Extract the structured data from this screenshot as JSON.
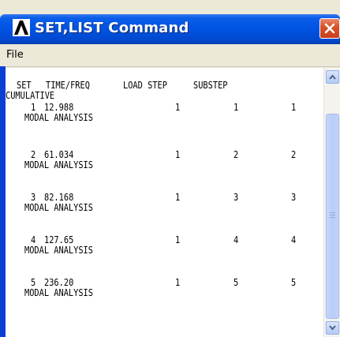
{
  "window": {
    "title": "SET,LIST Command",
    "menu": [
      "File"
    ]
  },
  "listing": {
    "headers": {
      "set": "SET",
      "time_freq": "TIME/FREQ",
      "load_step": "LOAD STEP",
      "substep": "SUBSTEP",
      "cumulative": "CUMULATIVE"
    },
    "rows": [
      {
        "set": "1",
        "time_freq": "12.988",
        "load_step": "1",
        "substep": "1",
        "cumulative": "1",
        "label": "MODAL ANALYSIS"
      },
      {
        "set": "2",
        "time_freq": "61.034",
        "load_step": "1",
        "substep": "2",
        "cumulative": "2",
        "label": "MODAL ANALYSIS"
      },
      {
        "set": "3",
        "time_freq": "82.168",
        "load_step": "1",
        "substep": "3",
        "cumulative": "3",
        "label": "MODAL ANALYSIS"
      },
      {
        "set": "4",
        "time_freq": "127.65",
        "load_step": "1",
        "substep": "4",
        "cumulative": "4",
        "label": "MODAL ANALYSIS"
      },
      {
        "set": "5",
        "time_freq": "236.20",
        "load_step": "1",
        "substep": "5",
        "cumulative": "5",
        "label": "MODAL ANALYSIS"
      }
    ]
  },
  "icons": {
    "app": "ansys-logo-icon",
    "close": "close-icon",
    "scroll_up": "arrow-up-icon",
    "scroll_down": "arrow-down-icon"
  },
  "colors": {
    "titlebar": "#0054e3",
    "close_button": "#d8532c",
    "window_face": "#ece9d8",
    "scroll_thumb": "#c6d6fa"
  }
}
